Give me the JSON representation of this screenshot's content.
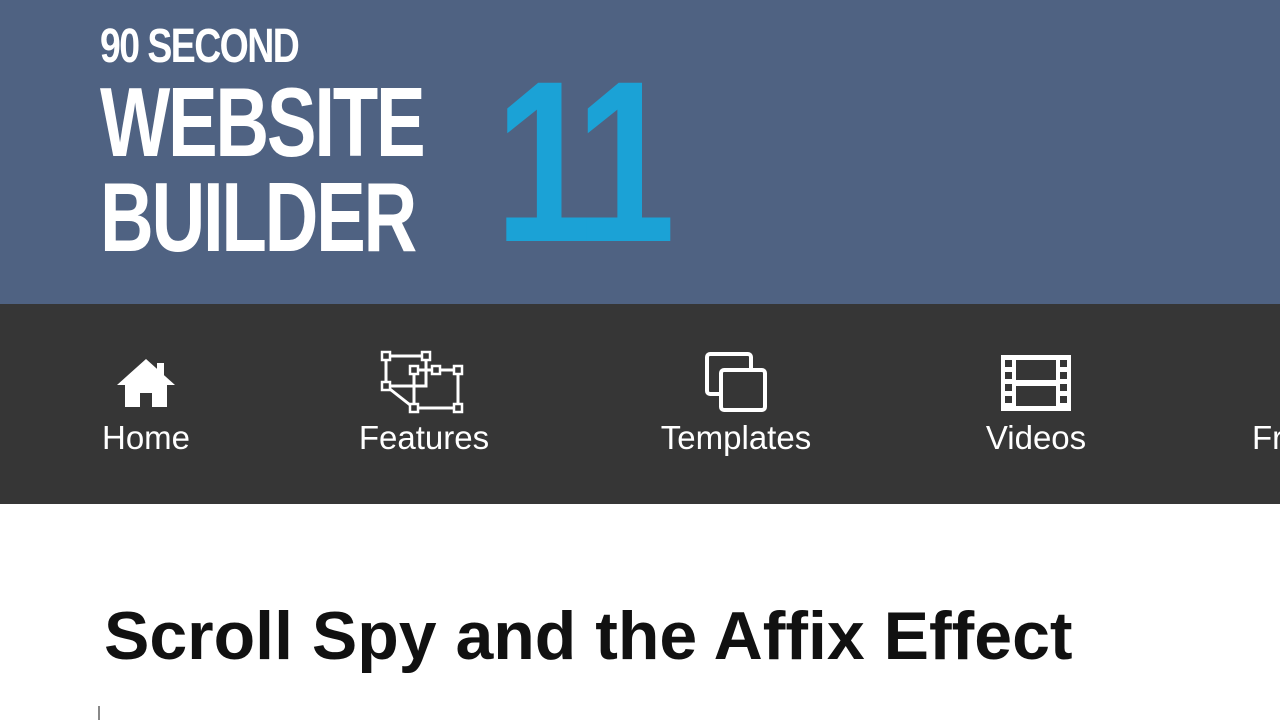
{
  "logo": {
    "line_small": "90 SECOND",
    "line1": "WEBSITE",
    "line2": "BUILDER",
    "number": "11",
    "colors": {
      "text": "#ffffff",
      "number": "#1ba2d6"
    }
  },
  "nav": {
    "items": [
      {
        "label": "Home",
        "icon": "home-icon"
      },
      {
        "label": "Features",
        "icon": "features-icon"
      },
      {
        "label": "Templates",
        "icon": "templates-icon"
      },
      {
        "label": "Videos",
        "icon": "videos-icon"
      },
      {
        "label": "Fr",
        "icon": ""
      }
    ]
  },
  "content": {
    "title": "Scroll Spy and the Affix Effect"
  },
  "colors": {
    "header_bg": "#4f6282",
    "nav_bg": "#363636",
    "page_bg": "#ffffff"
  }
}
